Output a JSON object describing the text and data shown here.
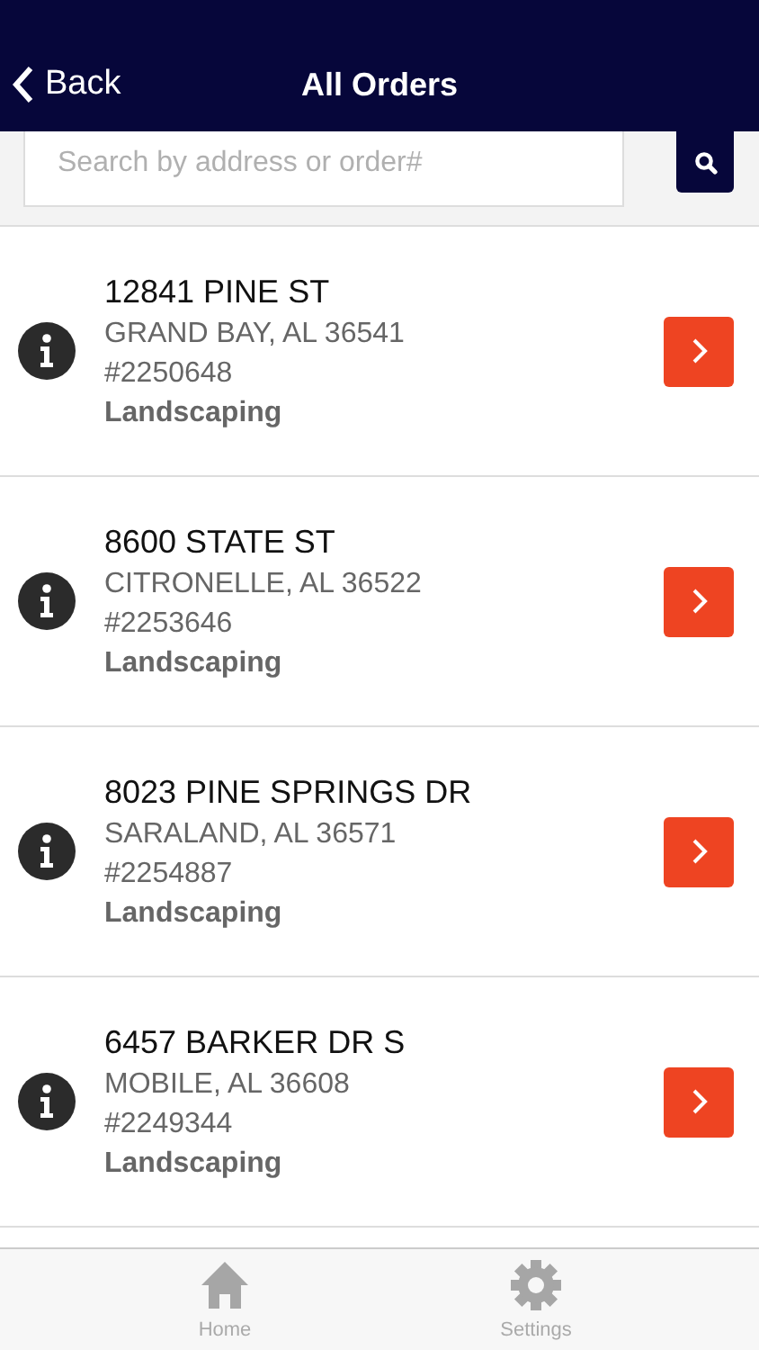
{
  "nav": {
    "back": "Back",
    "title": "All Orders"
  },
  "search": {
    "placeholder": "Search by address or order#"
  },
  "orders": [
    {
      "street": "12841 PINE ST",
      "city": "GRAND BAY, AL 36541",
      "number": "#2250648",
      "service": "Landscaping"
    },
    {
      "street": "8600 STATE ST",
      "city": "CITRONELLE, AL 36522",
      "number": "#2253646",
      "service": "Landscaping"
    },
    {
      "street": "8023 PINE SPRINGS DR",
      "city": "SARALAND, AL 36571",
      "number": "#2254887",
      "service": "Landscaping"
    },
    {
      "street": "6457 BARKER DR S",
      "city": "MOBILE, AL 36608",
      "number": "#2249344",
      "service": "Landscaping"
    }
  ],
  "tabs": [
    {
      "label": "Home",
      "kind": "home"
    },
    {
      "label": "Settings",
      "kind": "settings"
    }
  ]
}
